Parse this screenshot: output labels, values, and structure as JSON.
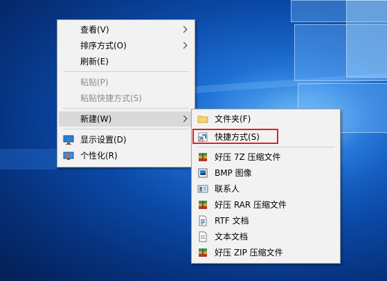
{
  "desktop": {
    "wallpaper": "windows-10-hero"
  },
  "context_menu": {
    "items": [
      {
        "label": "查看(V)",
        "submenu": true
      },
      {
        "label": "排序方式(O)",
        "submenu": true
      },
      {
        "label": "刷新(E)"
      },
      {
        "label": "粘贴(P)",
        "disabled": true
      },
      {
        "label": "粘贴快捷方式(S)",
        "disabled": true
      },
      {
        "label": "新建(W)",
        "submenu": true,
        "hovered": true
      },
      {
        "label": "显示设置(D)",
        "icon": "display-settings-icon"
      },
      {
        "label": "个性化(R)",
        "icon": "personalize-icon"
      }
    ]
  },
  "new_submenu": {
    "items": [
      {
        "label": "文件夹(F)",
        "icon": "folder-icon"
      },
      {
        "label": "快捷方式(S)",
        "icon": "shortcut-icon",
        "highlighted": true
      },
      {
        "label": "好压 7Z 压缩文件",
        "icon": "archive-icon"
      },
      {
        "label": "BMP 图像",
        "icon": "bmp-image-icon"
      },
      {
        "label": "联系人",
        "icon": "contact-icon"
      },
      {
        "label": "好压 RAR 压缩文件",
        "icon": "archive-icon"
      },
      {
        "label": "RTF 文档",
        "icon": "rtf-document-icon"
      },
      {
        "label": "文本文档",
        "icon": "text-document-icon"
      },
      {
        "label": "好压 ZIP 压缩文件",
        "icon": "archive-icon"
      }
    ]
  },
  "colors": {
    "highlight_border": "#e02020",
    "menu_bg": "#f2f2f2",
    "hover_bg": "#d9d9d9"
  }
}
